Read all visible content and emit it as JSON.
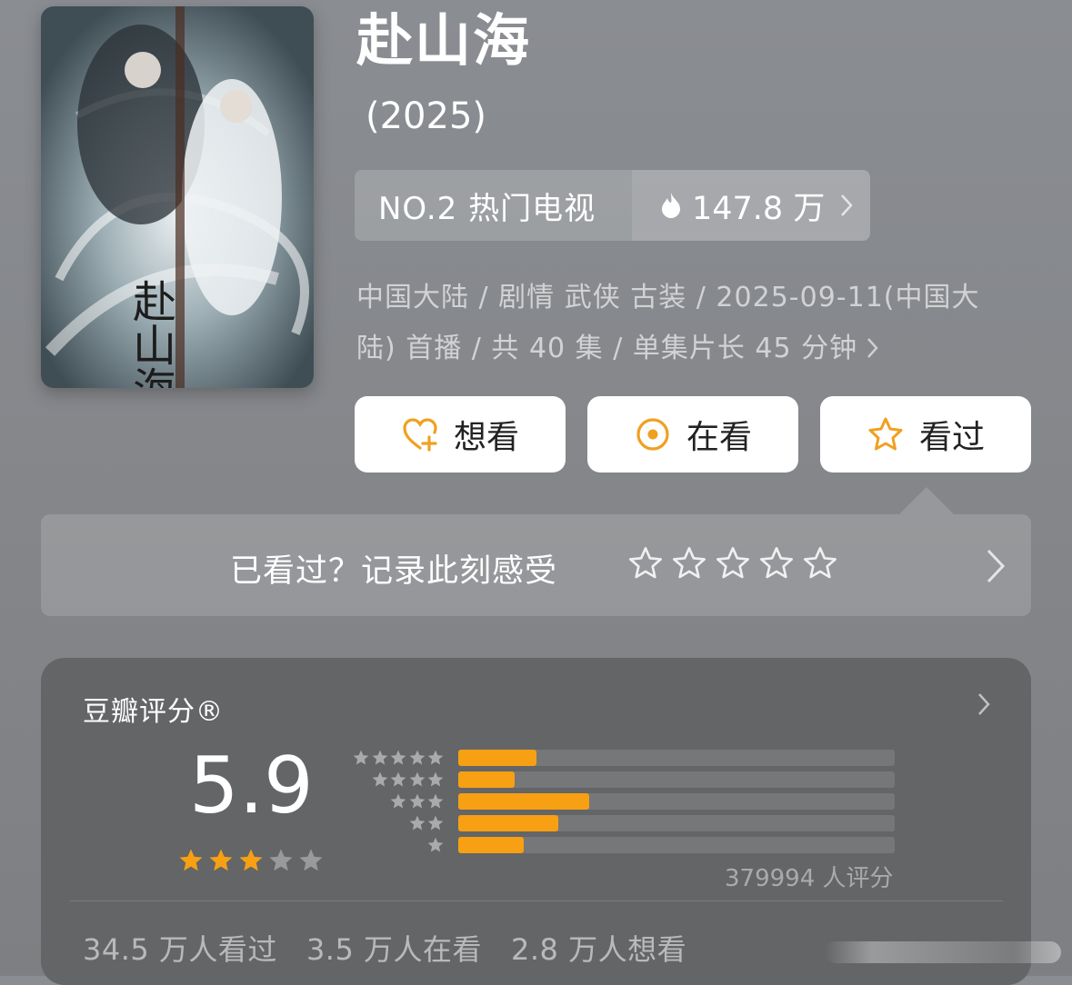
{
  "show": {
    "title": "赴山海",
    "year": "(2025)"
  },
  "rank": {
    "label": "NO.2 热门电视",
    "heat": "147.8 万",
    "icon": "flame-icon"
  },
  "meta": {
    "line1": "中国大陆 / 剧情 武侠 古装 / 2025-09-11(中国大",
    "line2": "陆) 首播 / 共 40 集 / 单集片长 45 分钟"
  },
  "actions": {
    "want": "想看",
    "watching": "在看",
    "watched": "看过"
  },
  "record": {
    "prompt": "已看过？记录此刻感受",
    "star_count": 5
  },
  "rating": {
    "header": "豆瓣评分®",
    "score": "5.9",
    "score_stars": 3,
    "count": "379994 人评分",
    "distribution": [
      {
        "stars": 5,
        "fraction": 0.18
      },
      {
        "stars": 4,
        "fraction": 0.13
      },
      {
        "stars": 3,
        "fraction": 0.3
      },
      {
        "stars": 2,
        "fraction": 0.23
      },
      {
        "stars": 1,
        "fraction": 0.15
      }
    ]
  },
  "stats": {
    "watched": "34.5 万人看过",
    "watching": "3.5 万人在看",
    "want": "2.8 万人想看"
  },
  "colors": {
    "accent": "#f7a013",
    "button_icon": "#f0a020"
  }
}
